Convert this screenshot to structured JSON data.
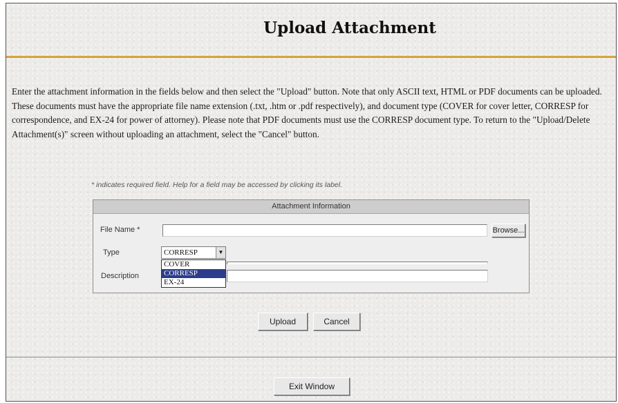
{
  "header": {
    "title": "Upload Attachment"
  },
  "instructions": "Enter the attachment information in the fields below and then select the \"Upload\" button. Note that only ASCII text, HTML or PDF documents can be uploaded. These documents must have the appropriate file name extension (.txt, .htm or .pdf respectively), and document type (COVER for cover letter, CORRESP for correspondence, and EX-24 for power of attorney). Please note that PDF documents must use the CORRESP document type. To return to the \"Upload/Delete Attachment(s)\" screen without uploading an attachment, select the \"Cancel\" button.",
  "required_note": "* indicates required field. Help for a field may be accessed by clicking its label.",
  "form": {
    "header": "Attachment Information",
    "file_name_label": "File Name *",
    "file_name_value": "",
    "browse_label": "Browse...",
    "type_label": "Type",
    "type_selected": "CORRESP",
    "type_options": [
      "COVER",
      "CORRESP",
      "EX-24"
    ],
    "description_label": "Description",
    "description_value": ""
  },
  "actions": {
    "upload_label": "Upload",
    "cancel_label": "Cancel"
  },
  "footer": {
    "exit_label": "Exit Window"
  },
  "colors": {
    "accent_rule": "#d4a53a",
    "selected_option": "#2b3c8a",
    "panel_header": "#cdcdcd"
  },
  "icons": {
    "select_arrow": "chevron-down-icon"
  }
}
